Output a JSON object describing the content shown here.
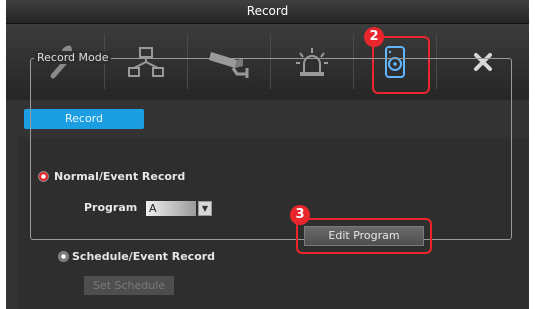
{
  "window": {
    "title": "Record"
  },
  "toolbar": {
    "items": [
      {
        "icon": "wrench-icon",
        "name": "settings"
      },
      {
        "icon": "network-icon",
        "name": "network"
      },
      {
        "icon": "camera-icon",
        "name": "camera"
      },
      {
        "icon": "alarm-icon",
        "name": "alarm"
      },
      {
        "icon": "record-disk-icon",
        "name": "record"
      },
      {
        "icon": "close-icon",
        "name": "close"
      }
    ]
  },
  "annotations": {
    "badge_toolbar": "2",
    "badge_edit": "3",
    "color": "#e8262c"
  },
  "tabs": {
    "record_label": "Record"
  },
  "record_mode": {
    "legend": "Record Mode",
    "normal_label": "Normal/Event Record",
    "program_label": "Program",
    "program_value": "A",
    "edit_program_label": "Edit Program",
    "schedule_label": "Schedule/Event Record",
    "set_schedule_label": "Set Schedule"
  },
  "colors": {
    "accent": "#1b9ee2",
    "selected_radio": "#e8262c"
  }
}
